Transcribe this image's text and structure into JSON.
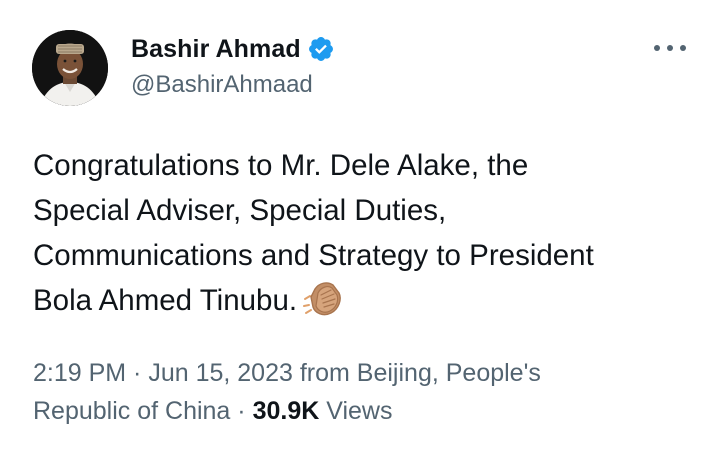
{
  "author": {
    "display_name": "Bashir Ahmad",
    "handle": "@BashirAhmaad",
    "verified": true,
    "verified_color": "#1d9bf0"
  },
  "tweet": {
    "text_lines": [
      "Congratulations to Mr. Dele Alake, the",
      "Special Adviser, Special Duties,",
      "Communications and Strategy to President",
      "Bola Ahmed Tinubu."
    ],
    "emoji": "clapping-hands-icon"
  },
  "meta": {
    "time": "2:19 PM",
    "separator": " · ",
    "date": "Jun 15, 2023",
    "location_line1": " from Beijing, People's",
    "location_line2": "Republic of China",
    "views_count": "30.9K",
    "views_label": " Views"
  },
  "menu": {
    "icon": "more-horizontal-icon"
  },
  "colors": {
    "text_primary": "#0f1419",
    "text_secondary": "#536471",
    "accent": "#1d9bf0"
  }
}
